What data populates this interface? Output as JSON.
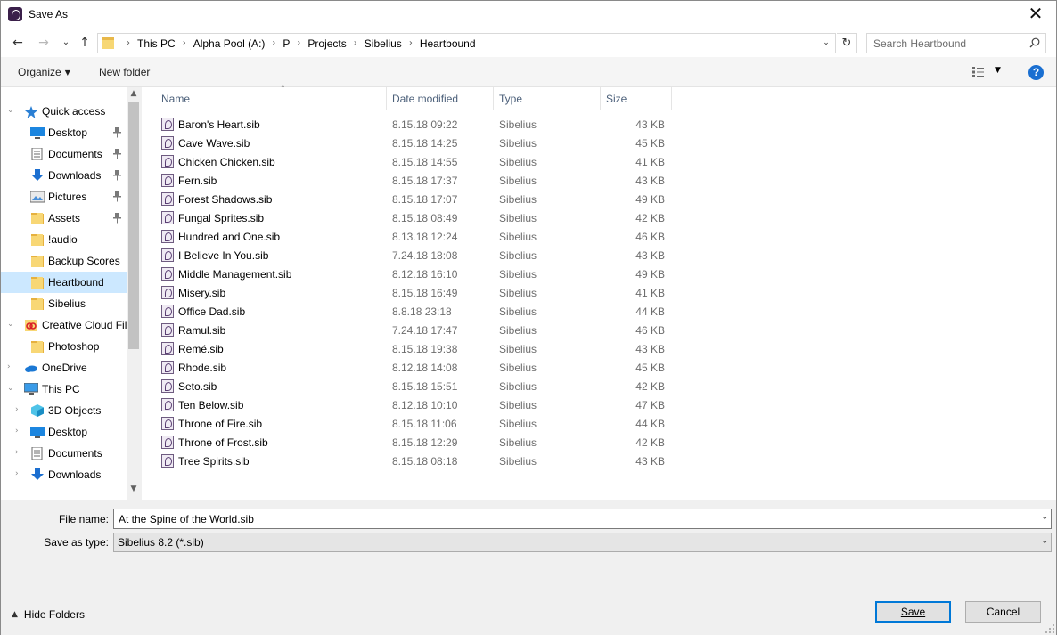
{
  "window": {
    "title": "Save As",
    "app_icon": "sibelius-icon",
    "close_glyph": "✕"
  },
  "nav": {
    "back_glyph": "←",
    "forward_glyph": "→",
    "recent_glyph": "⌄",
    "up_glyph": "↑",
    "breadcrumbs": [
      "This PC",
      "Alpha Pool (A:)",
      "P",
      "Projects",
      "Sibelius",
      "Heartbound"
    ],
    "refresh_glyph": "↻",
    "search_placeholder": "Search Heartbound"
  },
  "toolbar": {
    "organize_label": "Organize",
    "new_folder_label": "New folder",
    "help_glyph": "?"
  },
  "sidebar": {
    "items": [
      {
        "label": "Quick access",
        "icon": "star-icon",
        "indent": 0,
        "chevron": "⌄",
        "pinned": false,
        "selected": false
      },
      {
        "label": "Desktop",
        "icon": "desktop-icon",
        "indent": 1,
        "chevron": "",
        "pinned": true,
        "selected": false
      },
      {
        "label": "Documents",
        "icon": "documents-icon",
        "indent": 1,
        "chevron": "",
        "pinned": true,
        "selected": false
      },
      {
        "label": "Downloads",
        "icon": "downloads-icon",
        "indent": 1,
        "chevron": "",
        "pinned": true,
        "selected": false
      },
      {
        "label": "Pictures",
        "icon": "pictures-icon",
        "indent": 1,
        "chevron": "",
        "pinned": true,
        "selected": false
      },
      {
        "label": "Assets",
        "icon": "folder-icon",
        "indent": 1,
        "chevron": "",
        "pinned": true,
        "selected": false
      },
      {
        "label": "!audio",
        "icon": "folder-icon",
        "indent": 1,
        "chevron": "",
        "pinned": false,
        "selected": false
      },
      {
        "label": "Backup Scores",
        "icon": "folder-icon",
        "indent": 1,
        "chevron": "",
        "pinned": false,
        "selected": false
      },
      {
        "label": "Heartbound",
        "icon": "folder-icon",
        "indent": 1,
        "chevron": "",
        "pinned": false,
        "selected": true
      },
      {
        "label": "Sibelius",
        "icon": "folder-icon",
        "indent": 1,
        "chevron": "",
        "pinned": false,
        "selected": false
      },
      {
        "label": "Creative Cloud Fil",
        "icon": "creative-cloud-icon",
        "indent": 0,
        "chevron": "⌄",
        "pinned": false,
        "selected": false
      },
      {
        "label": "Photoshop",
        "icon": "folder-icon",
        "indent": 1,
        "chevron": "",
        "pinned": false,
        "selected": false
      },
      {
        "label": "OneDrive",
        "icon": "onedrive-icon",
        "indent": 0,
        "chevron": "›",
        "pinned": false,
        "selected": false
      },
      {
        "label": "This PC",
        "icon": "this-pc-icon",
        "indent": 0,
        "chevron": "⌄",
        "pinned": false,
        "selected": false
      },
      {
        "label": "3D Objects",
        "icon": "3d-objects-icon",
        "indent": 1,
        "chevron": "›",
        "pinned": false,
        "selected": false
      },
      {
        "label": "Desktop",
        "icon": "desktop-icon",
        "indent": 1,
        "chevron": "›",
        "pinned": false,
        "selected": false
      },
      {
        "label": "Documents",
        "icon": "documents-icon",
        "indent": 1,
        "chevron": "›",
        "pinned": false,
        "selected": false
      },
      {
        "label": "Downloads",
        "icon": "downloads-icon",
        "indent": 1,
        "chevron": "›",
        "pinned": false,
        "selected": false
      }
    ]
  },
  "filelist": {
    "columns": {
      "name": "Name",
      "date": "Date modified",
      "type": "Type",
      "size": "Size"
    },
    "files": [
      {
        "name": "Baron's Heart.sib",
        "date": "8.15.18 09:22",
        "type": "Sibelius",
        "size": "43 KB"
      },
      {
        "name": "Cave Wave.sib",
        "date": "8.15.18 14:25",
        "type": "Sibelius",
        "size": "45 KB"
      },
      {
        "name": "Chicken Chicken.sib",
        "date": "8.15.18 14:55",
        "type": "Sibelius",
        "size": "41 KB"
      },
      {
        "name": "Fern.sib",
        "date": "8.15.18 17:37",
        "type": "Sibelius",
        "size": "43 KB"
      },
      {
        "name": "Forest Shadows.sib",
        "date": "8.15.18 17:07",
        "type": "Sibelius",
        "size": "49 KB"
      },
      {
        "name": "Fungal Sprites.sib",
        "date": "8.15.18 08:49",
        "type": "Sibelius",
        "size": "42 KB"
      },
      {
        "name": "Hundred and One.sib",
        "date": "8.13.18 12:24",
        "type": "Sibelius",
        "size": "46 KB"
      },
      {
        "name": "I Believe In You.sib",
        "date": "7.24.18 18:08",
        "type": "Sibelius",
        "size": "43 KB"
      },
      {
        "name": "Middle Management.sib",
        "date": "8.12.18 16:10",
        "type": "Sibelius",
        "size": "49 KB"
      },
      {
        "name": "Misery.sib",
        "date": "8.15.18 16:49",
        "type": "Sibelius",
        "size": "41 KB"
      },
      {
        "name": "Office Dad.sib",
        "date": "8.8.18 23:18",
        "type": "Sibelius",
        "size": "44 KB"
      },
      {
        "name": "Ramul.sib",
        "date": "7.24.18 17:47",
        "type": "Sibelius",
        "size": "46 KB"
      },
      {
        "name": "Remé.sib",
        "date": "8.15.18 19:38",
        "type": "Sibelius",
        "size": "43 KB"
      },
      {
        "name": "Rhode.sib",
        "date": "8.12.18 14:08",
        "type": "Sibelius",
        "size": "45 KB"
      },
      {
        "name": "Seto.sib",
        "date": "8.15.18 15:51",
        "type": "Sibelius",
        "size": "42 KB"
      },
      {
        "name": "Ten Below.sib",
        "date": "8.12.18 10:10",
        "type": "Sibelius",
        "size": "47 KB"
      },
      {
        "name": "Throne of Fire.sib",
        "date": "8.15.18 11:06",
        "type": "Sibelius",
        "size": "44 KB"
      },
      {
        "name": "Throne of Frost.sib",
        "date": "8.15.18 12:29",
        "type": "Sibelius",
        "size": "42 KB"
      },
      {
        "name": "Tree Spirits.sib",
        "date": "8.15.18 08:18",
        "type": "Sibelius",
        "size": "43 KB"
      }
    ]
  },
  "form": {
    "file_name_label": "File name:",
    "file_name_value": "At the Spine of the World.sib",
    "save_type_label": "Save as type:",
    "save_type_value": "Sibelius 8.2 (*.sib)",
    "hide_folders_label": "Hide Folders",
    "save_label": "Save",
    "cancel_label": "Cancel"
  },
  "colors": {
    "accent": "#0078d7",
    "selection": "#cce8ff",
    "header_text": "#4c607a"
  }
}
